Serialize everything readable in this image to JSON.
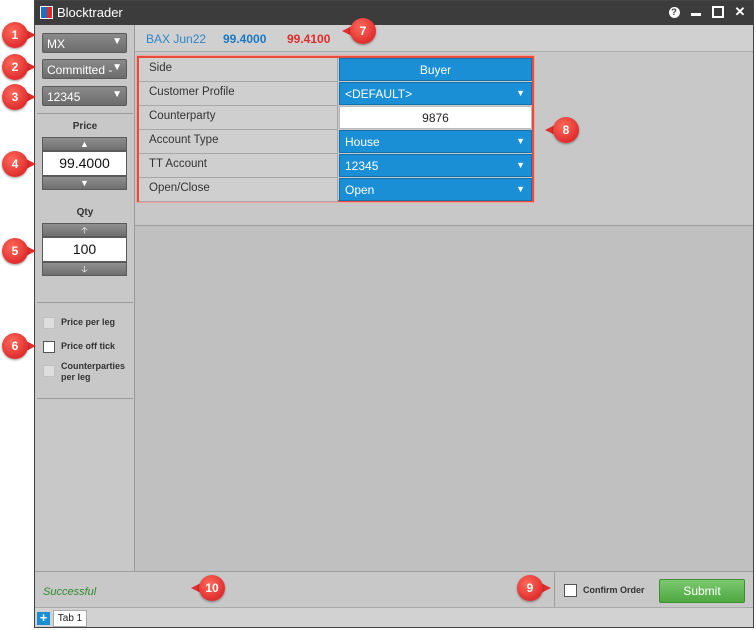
{
  "window": {
    "title": "Blocktrader"
  },
  "left": {
    "exchange_dropdown": "MX",
    "status_dropdown": "Committed -",
    "account_dropdown": "12345",
    "price_label": "Price",
    "price_value": "99.4000",
    "qty_label": "Qty",
    "qty_value": "100",
    "checkboxes": [
      {
        "label": "Price per leg",
        "checked": false
      },
      {
        "label": "Price off tick",
        "checked": false
      },
      {
        "label": "Counterparties per leg",
        "checked": false
      }
    ]
  },
  "instrument": {
    "name": "BAX Jun22",
    "bid": "99.4000",
    "ask": "99.4100"
  },
  "form": {
    "rows": [
      {
        "label": "Side",
        "value": "Buyer"
      },
      {
        "label": "Customer Profile",
        "value": "<DEFAULT>"
      },
      {
        "label": "Counterparty",
        "value": "9876"
      },
      {
        "label": "Account Type",
        "value": "House"
      },
      {
        "label": "TT Account",
        "value": "12345"
      },
      {
        "label": "Open/Close",
        "value": "Open"
      }
    ]
  },
  "footer": {
    "status": "Successful",
    "confirm_label": "Confirm Order",
    "submit_label": "Submit"
  },
  "tabs": [
    {
      "label": "Tab 1"
    }
  ],
  "callouts": [
    "1",
    "2",
    "3",
    "4",
    "5",
    "6",
    "7",
    "8",
    "9",
    "10"
  ],
  "colors": {
    "accent_blue": "#1a8fd6",
    "ask_red": "#e02b2b",
    "submit_green": "#5cb84f",
    "callout_red": "#e02e2e",
    "status_green": "#2e8b2e"
  }
}
